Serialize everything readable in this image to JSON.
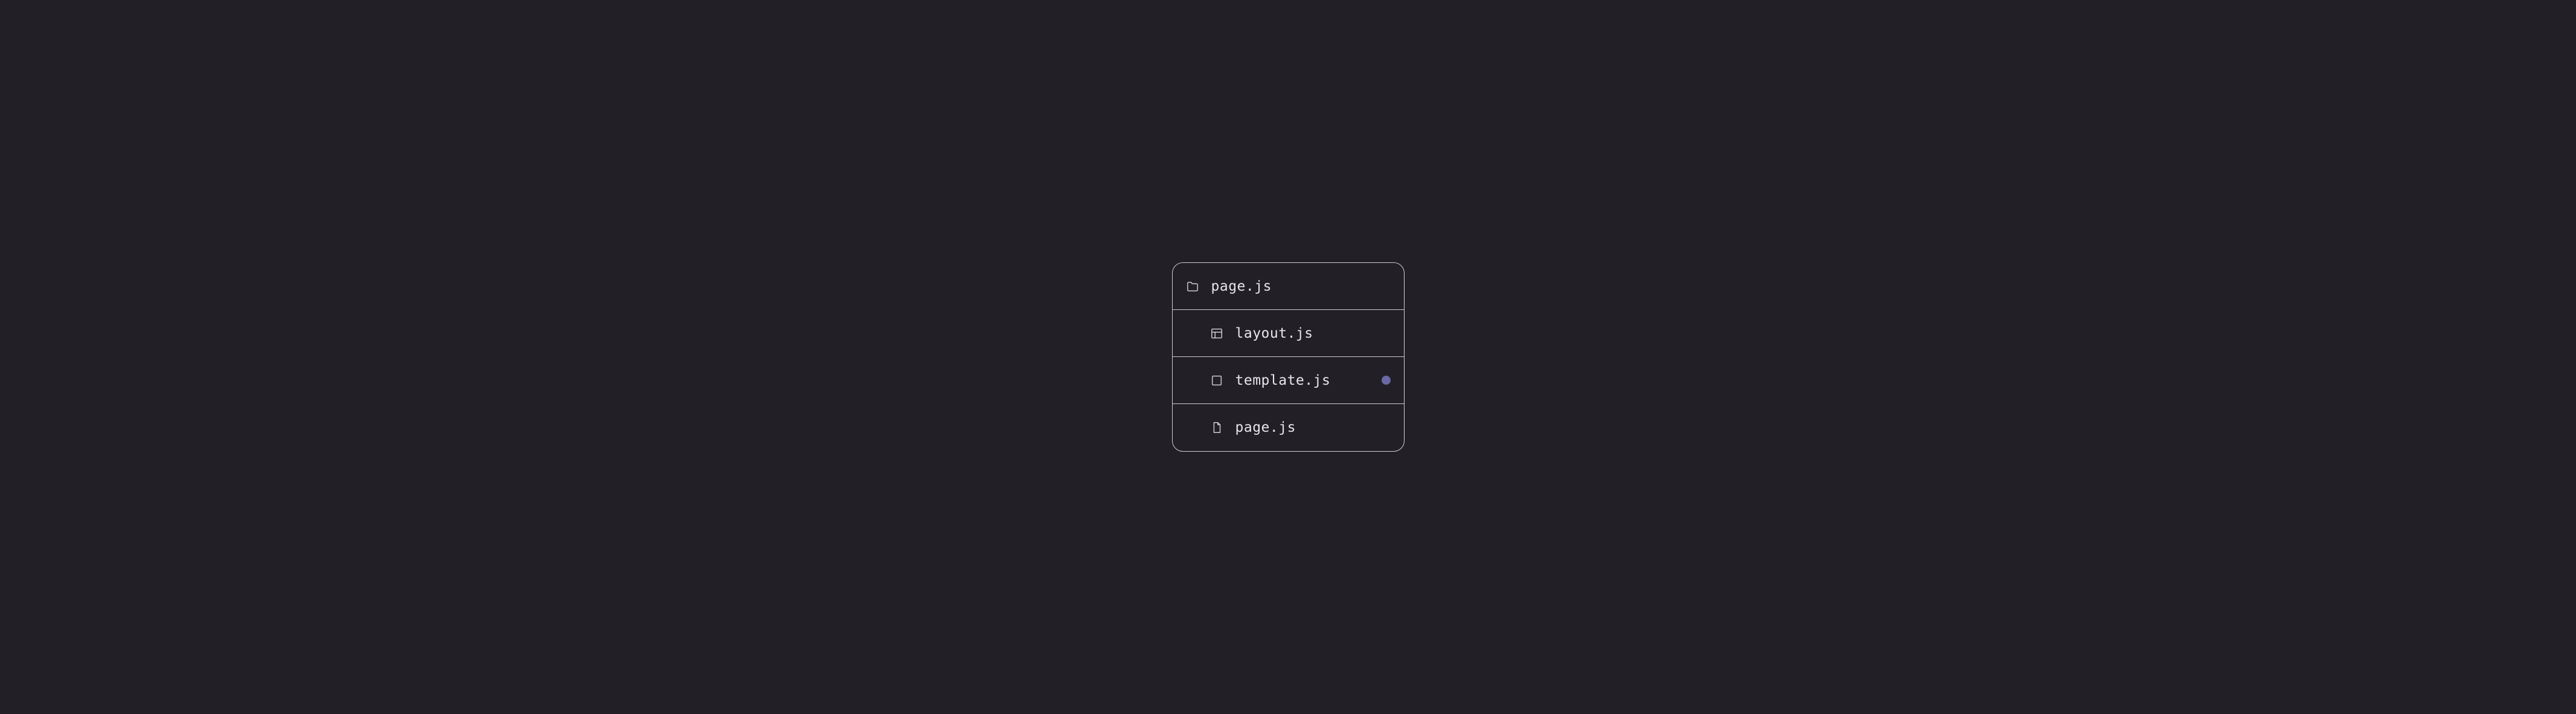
{
  "files": [
    {
      "icon": "folder",
      "label": "page.js",
      "indent": false,
      "marker": false
    },
    {
      "icon": "layout",
      "label": "layout.js",
      "indent": true,
      "marker": false
    },
    {
      "icon": "template",
      "label": "template.js",
      "indent": true,
      "marker": true
    },
    {
      "icon": "file",
      "label": "page.js",
      "indent": true,
      "marker": false
    }
  ],
  "marker_color": "#6a68a5"
}
